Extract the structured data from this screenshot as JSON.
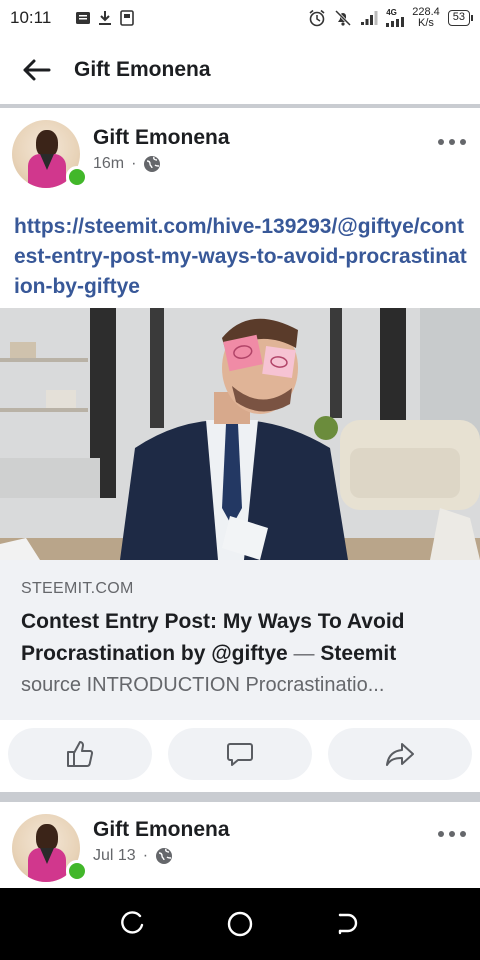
{
  "status_bar": {
    "time": "10:11",
    "network_type": "4G",
    "net_speed_value": "228.4",
    "net_speed_unit": "K/s",
    "battery": "53",
    "icons": [
      "message-icon",
      "download-icon",
      "sim-card-icon",
      "alarm-icon",
      "mute-icon",
      "signal-icon",
      "signal-4g-icon"
    ]
  },
  "header": {
    "title": "Gift Emonena",
    "back_icon": "arrow-left-icon"
  },
  "post": {
    "author": "Gift Emonena",
    "time": "16m",
    "separator": "·",
    "privacy_icon": "globe-icon",
    "more_icon": "more-horizontal-icon",
    "link_text": "https://steemit.com/hive-139293/@giftye/contest-entry-post-my-ways-to-avoid-procrastination-by-giftye",
    "preview": {
      "domain": "STEEMIT.COM",
      "title": "Contest Entry Post: My Ways To Avoid Procrastination by @giftye",
      "title_sep": "—",
      "site": "Steemit",
      "description": "source INTRODUCTION Procrastinatio..."
    },
    "actions": [
      {
        "name": "like",
        "icon": "thumbs-up-icon"
      },
      {
        "name": "comment",
        "icon": "comment-icon"
      },
      {
        "name": "share",
        "icon": "share-icon"
      }
    ]
  },
  "post2": {
    "author": "Gift Emonena",
    "time": "Jul 13",
    "separator": "·"
  },
  "nav": {
    "icons": [
      "recent-apps-icon",
      "home-icon",
      "back-icon"
    ]
  },
  "colors": {
    "link": "#385898",
    "online": "#42b72a",
    "muted": "#65676b",
    "panel": "#f0f2f5"
  }
}
